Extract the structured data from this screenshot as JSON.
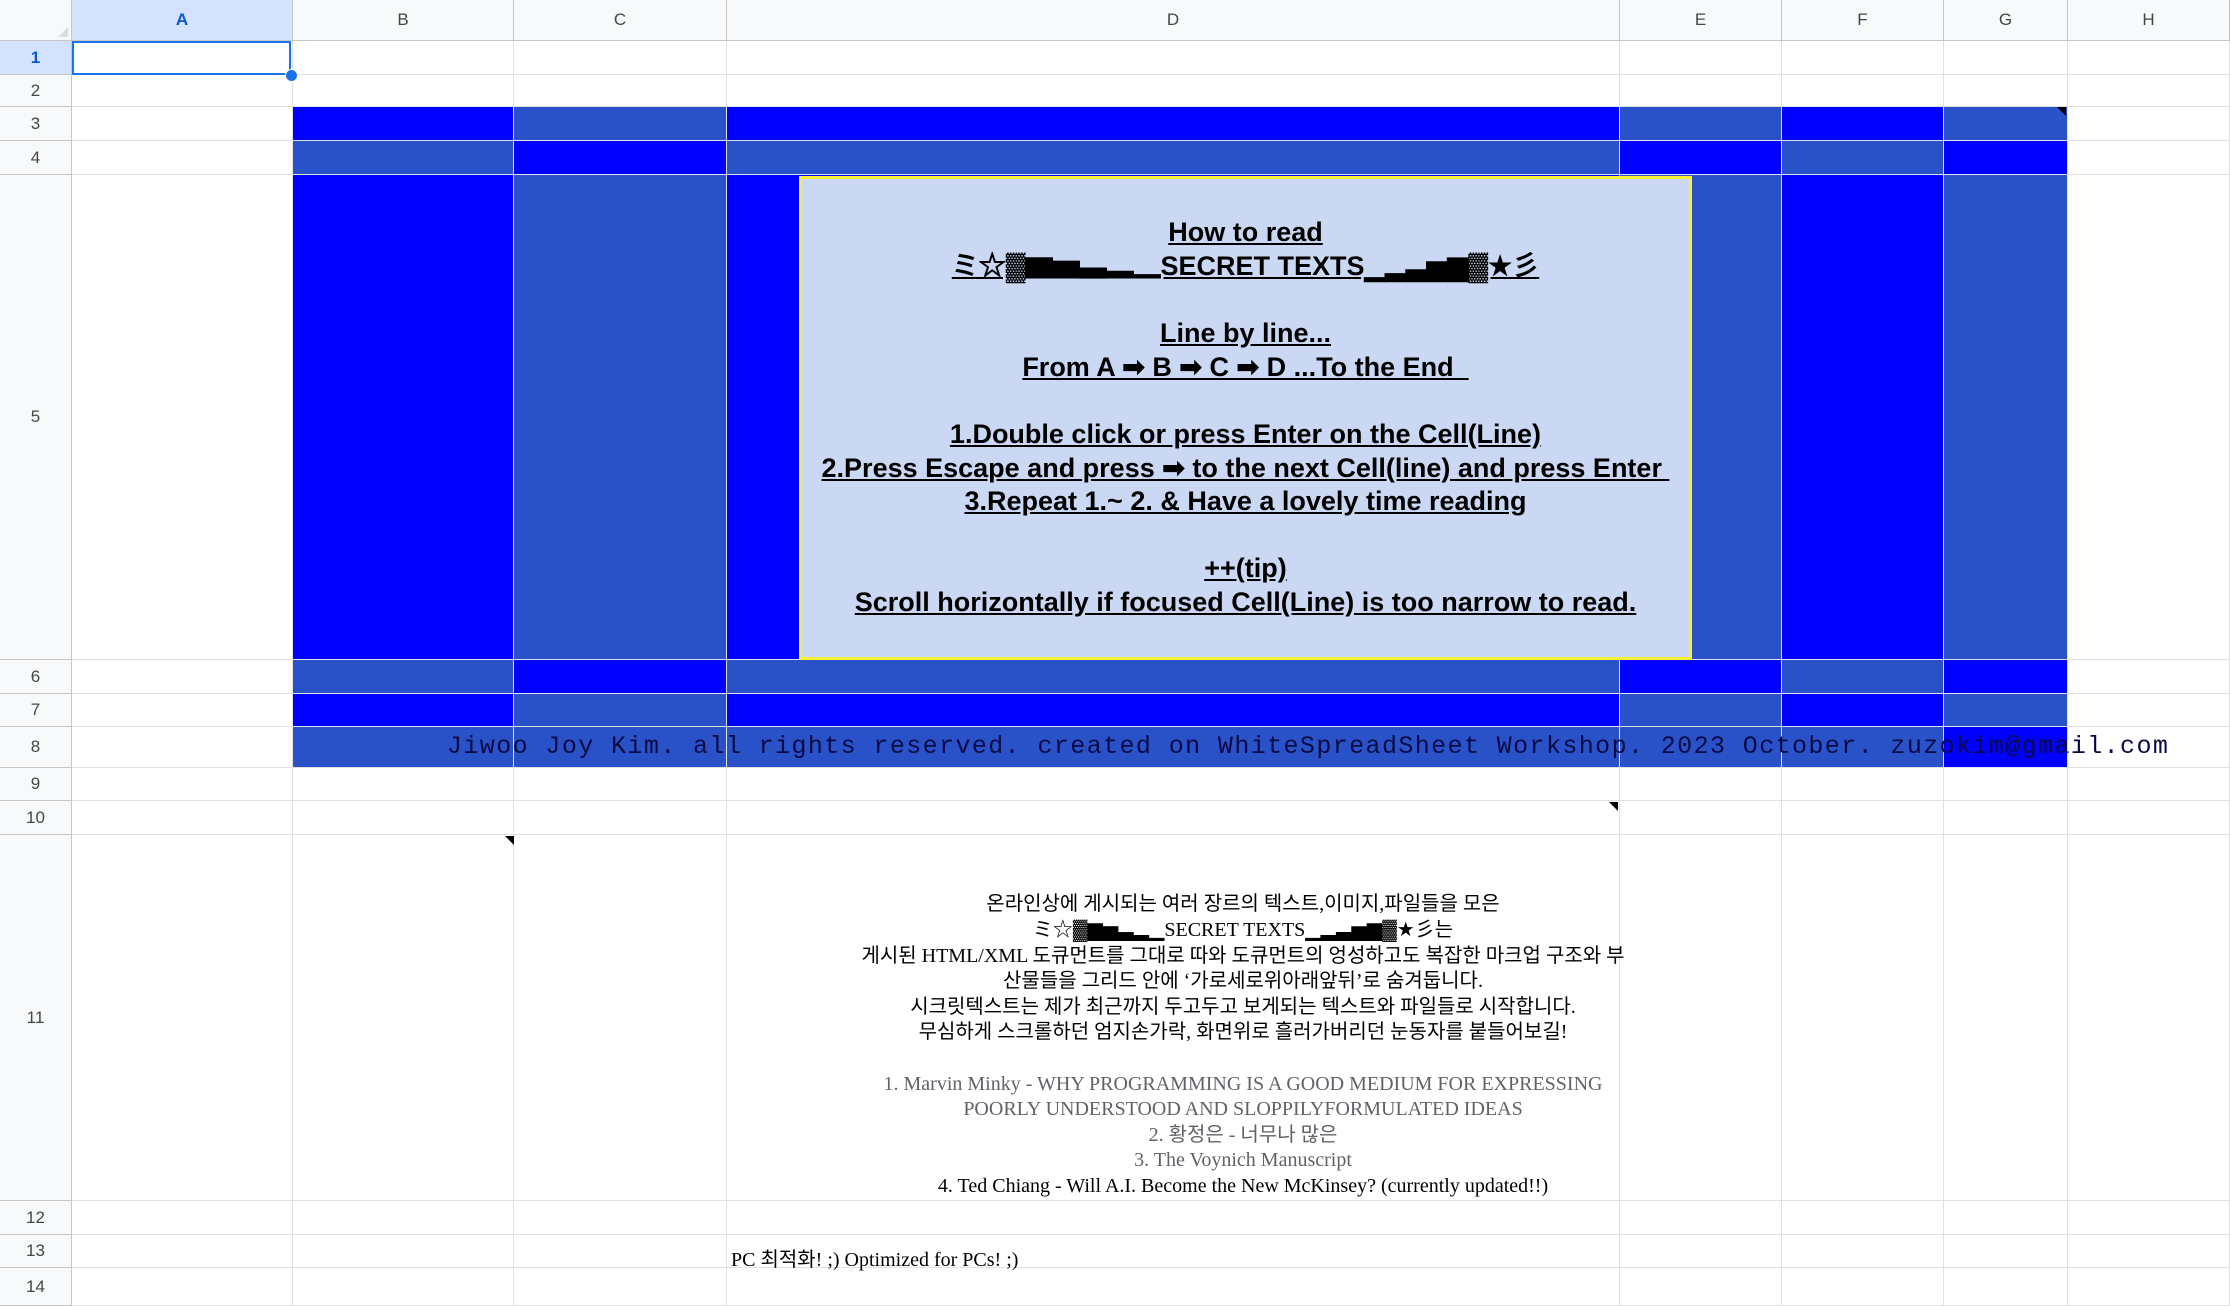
{
  "spreadsheet": {
    "columns": [
      "A",
      "B",
      "C",
      "D",
      "E",
      "F",
      "G",
      "H"
    ],
    "rows": [
      "1",
      "2",
      "3",
      "4",
      "5",
      "6",
      "7",
      "8",
      "9",
      "10",
      "11",
      "12",
      "13",
      "14"
    ],
    "selected_cell": "A1"
  },
  "colors": {
    "blue_bright": "#0000fe",
    "blue_medium": "#2a52c8",
    "panel_fill": "#cad8f4",
    "panel_border": "#f6f135",
    "selection": "#1a73e8",
    "header_selected": "#d3e3fd"
  },
  "instructions": {
    "lines": [
      "How to read",
      "ミ☆▓▆▅▃▂▁SECRET TEXTS▁▂▃▅▆▓★彡",
      "",
      "Line by line...",
      "From A ➡ B ➡ C ➡ D ...To the End  ",
      "",
      "1.Double click or press Enter on the Cell(Line)",
      "2.Press Escape and press ➡ to the next Cell(line) and press Enter ",
      "3.Repeat 1.~ 2. & Have a lovely time reading",
      "",
      "++(tip)",
      "Scroll horizontally if focused Cell(Line) is too narrow to read."
    ]
  },
  "footer": {
    "text": "Jiwoo Joy Kim. all rights reserved. created on WhiteSpreadSheet Workshop. 2023 October. zuzokim@gmail.com"
  },
  "intro": {
    "lines": [
      {
        "text": "온라인상에 게시되는 여러 장르의 텍스트,이미지,파일들을 모은",
        "gray": false
      },
      {
        "text": "ミ☆▓▆▅▃▂▁SECRET TEXTS▁▂▃▅▆▓★彡는",
        "gray": false
      },
      {
        "text": "게시된 HTML/XML 도큐먼트를 그대로 따와 도큐먼트의 엉성하고도 복잡한 마크업 구조와 부",
        "gray": false
      },
      {
        "text": "산물들을 그리드 안에 ‘가로세로위아래앞뒤’로 숨겨둡니다.",
        "gray": false
      },
      {
        "text": "시크릿텍스트는 제가 최근까지 두고두고 보게되는 텍스트와 파일들로 시작합니다.",
        "gray": false
      },
      {
        "text": "무심하게 스크롤하던 엄지손가락, 화면위로 흘러가버리던 눈동자를 붙들어보길!",
        "gray": false
      },
      {
        "text": "",
        "gray": false
      },
      {
        "text": "1. Marvin Minky - WHY PROGRAMMING IS A GOOD MEDIUM FOR EXPRESSING",
        "gray": true
      },
      {
        "text": "POORLY UNDERSTOOD AND SLOPPILYFORMULATED IDEAS",
        "gray": true
      },
      {
        "text": "2. 황정은 - 너무나 많은",
        "gray": true
      },
      {
        "text": "3. The Voynich Manuscript",
        "gray": true
      },
      {
        "text": "4. Ted Chiang - Will A.I. Become the New McKinsey? (currently updated!!)",
        "gray": false
      }
    ]
  },
  "notes": {
    "pc_optimized": "PC 최적화! ;) Optimized for PCs! ;)"
  }
}
